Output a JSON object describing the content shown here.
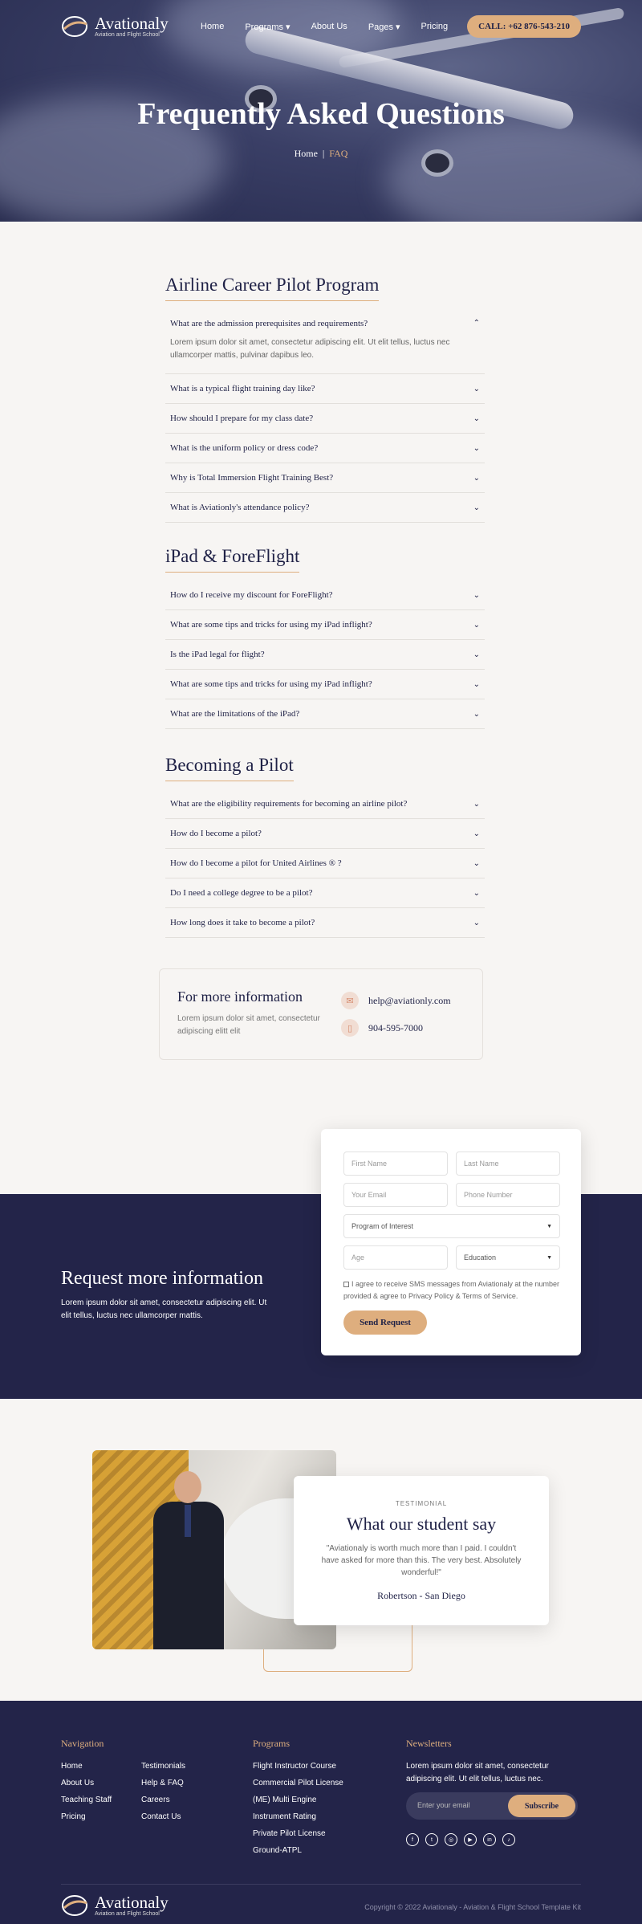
{
  "brand": {
    "name": "Avationaly",
    "tagline": "Aviation and Flight School",
    "accent": "#deae7e",
    "navy": "#232449"
  },
  "nav": {
    "links": [
      "Home",
      "Programs",
      "About Us",
      "Pages",
      "Pricing"
    ],
    "call_label": "CALL: +62 876-543-210"
  },
  "hero": {
    "title": "Frequently Asked Questions",
    "breadcrumb_home": "Home",
    "breadcrumb_sep": "|",
    "breadcrumb_current": "FAQ"
  },
  "faq": [
    {
      "heading": "Airline Career Pilot Program",
      "items": [
        {
          "q": "What are the admission prerequisites and requirements?",
          "a": "Lorem ipsum dolor sit amet, consectetur adipiscing elit. Ut elit tellus, luctus nec ullamcorper mattis, pulvinar dapibus leo.",
          "open": true
        },
        {
          "q": "What is a typical flight training day like?"
        },
        {
          "q": "How should I prepare for my class date?"
        },
        {
          "q": "What is the uniform policy or dress code?"
        },
        {
          "q": "Why is Total Immersion Flight Training Best?"
        },
        {
          "q": "What is Aviationly's attendance policy?"
        }
      ]
    },
    {
      "heading": "iPad & ForeFlight",
      "items": [
        {
          "q": "How do I receive my discount for ForeFlight?"
        },
        {
          "q": "What are some tips and tricks for using my iPad inflight?"
        },
        {
          "q": "Is the iPad legal for flight?"
        },
        {
          "q": "What are some tips and tricks for using my iPad inflight?"
        },
        {
          "q": "What are the limitations of the iPad?"
        }
      ]
    },
    {
      "heading": "Becoming a Pilot",
      "items": [
        {
          "q": "What are the eligibility requirements for becoming an airline pilot?"
        },
        {
          "q": "How do I become a pilot?"
        },
        {
          "q": "How do I become a pilot for United Airlines ® ?"
        },
        {
          "q": "Do I need a college degree to be a pilot?"
        },
        {
          "q": "How long does it take to become a pilot?"
        }
      ]
    }
  ],
  "more_info": {
    "title": "For more information",
    "text": "Lorem ipsum dolor sit amet, consectetur adipiscing elitt elit",
    "email": "help@aviationly.com",
    "phone": "904-595-7000"
  },
  "request": {
    "title": "Request more information",
    "text": "Lorem ipsum dolor sit amet, consectetur adipiscing elit. Ut elit tellus, luctus nec ullamcorper mattis.",
    "form": {
      "first_name": "First Name",
      "last_name": "Last Name",
      "email": "Your Email",
      "phone": "Phone Number",
      "program": "Program of Interest",
      "age": "Age",
      "education": "Education",
      "agree": "I agree to receive SMS messages from Aviationaly at the number provided & agree to Privacy Policy & Terms of Service.",
      "submit": "Send Request"
    }
  },
  "testimonial": {
    "label": "TESTIMONIAL",
    "title": "What our student say",
    "quote": "\"Aviationaly is worth much more than I paid. I couldn't have asked for more than this. The very best. Absolutely wonderful!\"",
    "author": "Robertson - San Diego"
  },
  "footer": {
    "nav_heading": "Navigation",
    "nav_col1": [
      "Home",
      "About Us",
      "Teaching Staff",
      "Pricing"
    ],
    "nav_col2": [
      "Testimonials",
      "Help & FAQ",
      "Careers",
      "Contact Us"
    ],
    "programs_heading": "Programs",
    "programs": [
      "Flight Instructor Course",
      "Commercial Pilot License",
      "(ME) Multi Engine",
      "Instrument Rating",
      "Private Pilot License",
      "Ground-ATPL"
    ],
    "news_heading": "Newsletters",
    "news_text": "Lorem ipsum dolor sit amet, consectetur adipiscing elit. Ut elit tellus, luctus nec.",
    "email_placeholder": "Enter your email",
    "subscribe": "Subscribe",
    "socials": [
      "facebook-icon",
      "twitter-icon",
      "instagram-icon",
      "youtube-icon",
      "linkedin-icon",
      "tiktok-icon"
    ],
    "copyright": "Copyright © 2022 Aviationaly - Aviation & Flight School Template Kit"
  }
}
